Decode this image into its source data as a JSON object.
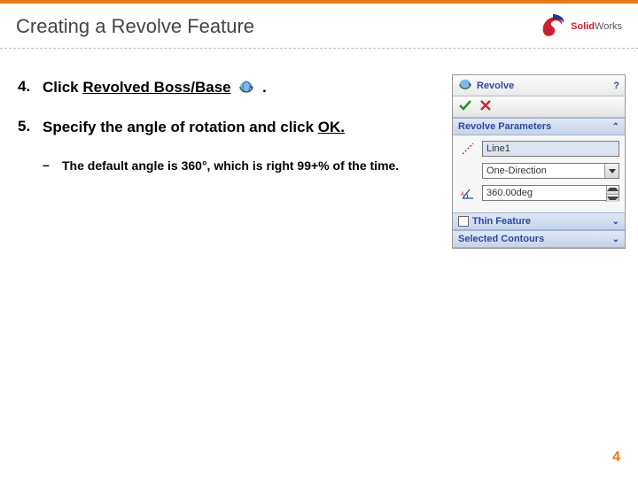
{
  "title": "Creating a Revolve Feature",
  "logo": {
    "brand_left": "Solid",
    "brand_right": "Works"
  },
  "steps": {
    "s4": {
      "num": "4.",
      "pre": "Click ",
      "bold": "Revolved Boss/Base",
      "post": "   ."
    },
    "s5": {
      "num": "5.",
      "text": "Specify the angle of rotation and click ",
      "ok": "OK."
    },
    "sub": {
      "dash": "–",
      "text": "The default angle is 360°, which is right 99+% of the time."
    }
  },
  "panel": {
    "title": "Revolve",
    "help": "?",
    "revolve_params_hdr": "Revolve Parameters",
    "axis_value": "Line1",
    "dir_value": "One-Direction",
    "angle_value": "360.00deg",
    "thin_hdr": "Thin Feature",
    "sel_contours_hdr": "Selected Contours"
  },
  "page_num": "4"
}
